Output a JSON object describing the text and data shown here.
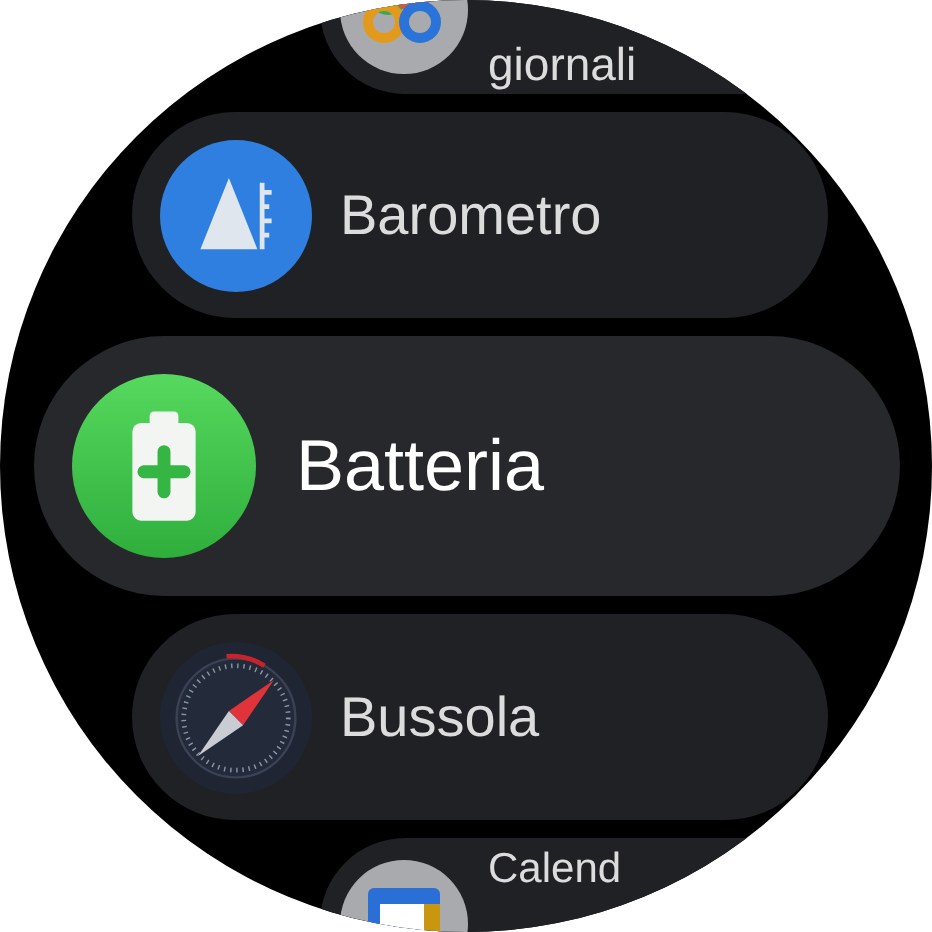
{
  "apps": [
    {
      "label": "giornali",
      "kind": "activity",
      "focused": false
    },
    {
      "label": "Barometro",
      "kind": "barometer",
      "focused": false
    },
    {
      "label": "Batteria",
      "kind": "battery",
      "focused": true
    },
    {
      "label": "Bussola",
      "kind": "compass",
      "focused": false
    },
    {
      "label": "Calend",
      "kind": "calendar",
      "focused": false
    }
  ]
}
